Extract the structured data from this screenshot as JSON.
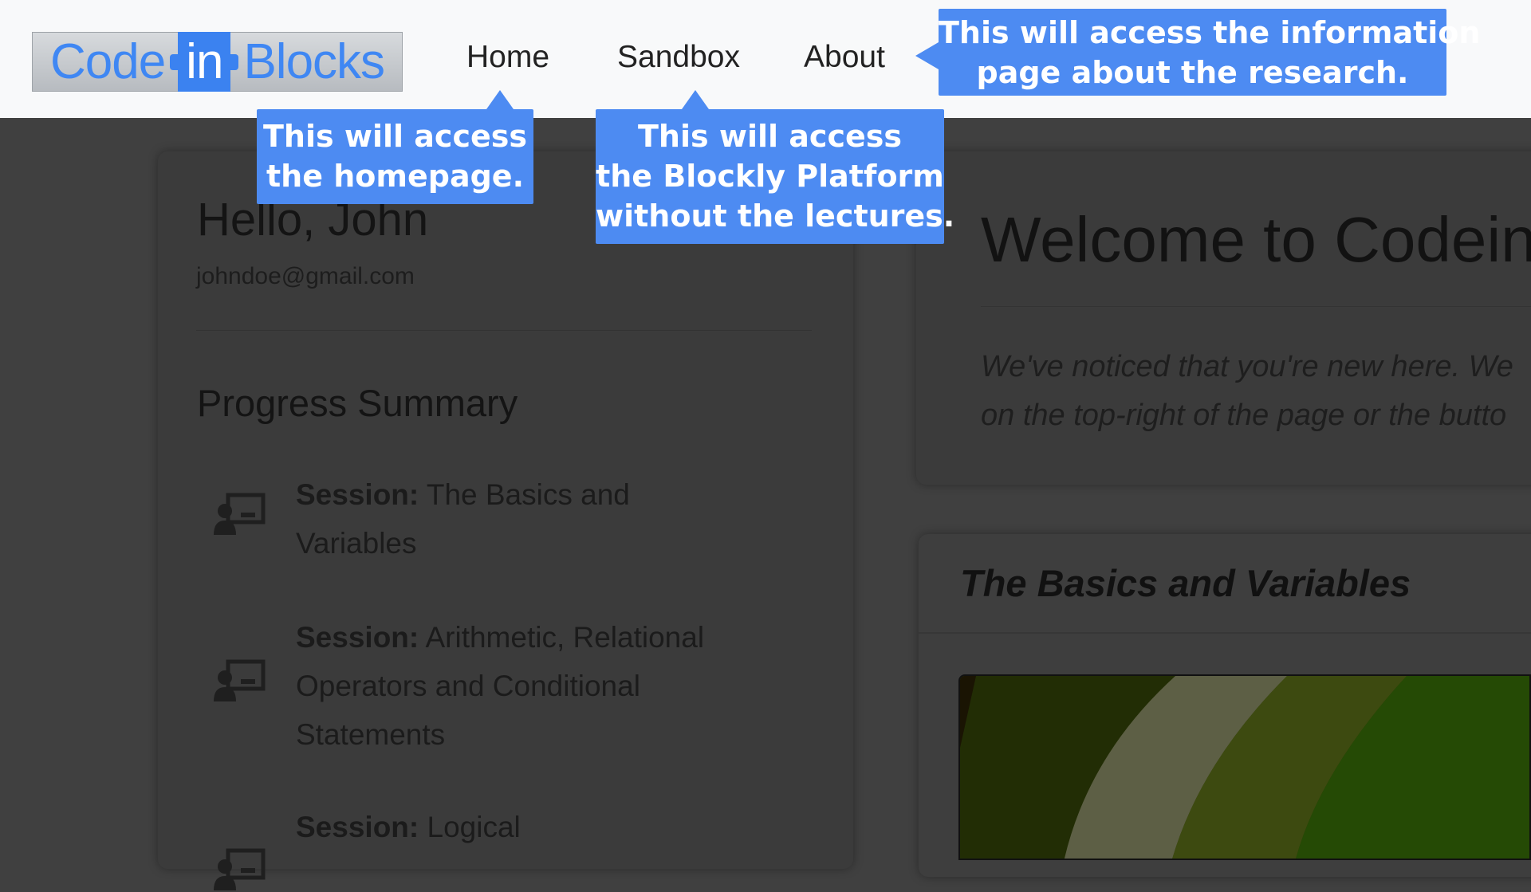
{
  "logo": {
    "part1": "Code",
    "part2": "in",
    "part3": "Blocks"
  },
  "nav": {
    "home": "Home",
    "sandbox": "Sandbox",
    "about": "About"
  },
  "callouts": {
    "home": [
      "This will access",
      "the homepage."
    ],
    "sandbox": [
      "This will access",
      "the Blockly Platform",
      "without the lectures."
    ],
    "about": [
      "This will access the information",
      "page about the research."
    ]
  },
  "profile": {
    "greeting": "Hello, John",
    "email": "johndoe@gmail.com",
    "progress_title": "Progress Summary",
    "session_label": "Session:",
    "sessions": [
      {
        "name": "The Basics and Variables",
        "icon": "teacher-icon"
      },
      {
        "name": "Arithmetic, Relational Operators and Conditional Statements",
        "icon": "teacher-icon"
      },
      {
        "name": "Logical",
        "icon": "teacher-icon"
      }
    ]
  },
  "welcome": {
    "title": "Welcome to Codein",
    "text_line1": "We've noticed that you're new here. We",
    "text_line2": "on the top-right of the page or the butto"
  },
  "lesson": {
    "title": "The Basics and Variables"
  },
  "colors": {
    "callout": "#4d8bf2",
    "logo_blue": "#3b82f0",
    "overlay": "#404040",
    "navbar": "#f8f9fa"
  }
}
